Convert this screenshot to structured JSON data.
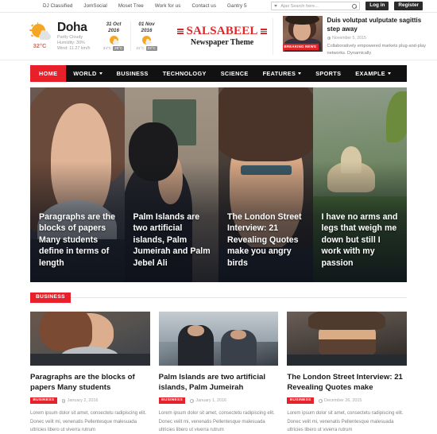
{
  "topbar": {
    "links": [
      {
        "label": "DJ Classified"
      },
      {
        "label": "JomSocial"
      },
      {
        "label": "Moset Tree"
      },
      {
        "label": "Work for us"
      },
      {
        "label": "Contact us"
      },
      {
        "label": "Gantry 5"
      }
    ],
    "search_placeholder": "Ajax Search here...",
    "login_label": "Log in",
    "register_label": "Register"
  },
  "weather": {
    "city": "Doha",
    "condition": "Partly Cloudy",
    "humidity": "Humidity: 30%",
    "wind": "Wind: 11.27 km/h",
    "current_temp": "32°C",
    "forecast": [
      {
        "date_line1": "31 Oct",
        "date_line2": "2016",
        "low": "34°C",
        "high": "28°C"
      },
      {
        "date_line1": "01 Nov",
        "date_line2": "2016",
        "low": "31°C",
        "high": "23°C"
      }
    ]
  },
  "logo": {
    "name": "SALSABEEL",
    "tagline": "Newspaper Theme"
  },
  "breaking": {
    "badge": "BREAKING NEWS",
    "title": "Duis volutpat vulputate sagittis step away",
    "date": "November 5, 2015",
    "excerpt": "Collaboratively empowered markets plug-and-play networks. Dynamically"
  },
  "nav": [
    {
      "label": "HOME",
      "caret": false,
      "active": true
    },
    {
      "label": "WORLD",
      "caret": true,
      "active": false
    },
    {
      "label": "BUSINESS",
      "caret": false,
      "active": false
    },
    {
      "label": "TECHNOLOGY",
      "caret": false,
      "active": false
    },
    {
      "label": "SCIENCE",
      "caret": false,
      "active": false
    },
    {
      "label": "FEATURES",
      "caret": true,
      "active": false
    },
    {
      "label": "SPORTS",
      "caret": false,
      "active": false
    },
    {
      "label": "EXAMPLE",
      "caret": true,
      "active": false
    }
  ],
  "hero": [
    {
      "caption": "Paragraphs are the blocks of papers Many students define in terms of length"
    },
    {
      "caption": "Palm Islands are two artificial islands, Palm Jumeirah and Palm Jebel Ali"
    },
    {
      "caption": "The London Street Interview: 21 Revealing Quotes make you angry birds"
    },
    {
      "caption": "I have no arms and legs that weigh me down but still I work with my passion"
    }
  ],
  "business_section": {
    "tag": "BUSINESS",
    "cards": [
      {
        "title": "Paragraphs are the blocks of papers Many students",
        "tag": "BUSINESS",
        "date": "January 2, 2016",
        "excerpt": "Lorem ipsum dolor sit amet, consectetu radipiscing elit. Donec velit mi, venenatis Pellentesque malesuada ultricies libero ut viverra rutrum"
      },
      {
        "title": "Palm Islands are two artificial islands, Palm Jumeirah",
        "tag": "BUSINESS",
        "date": "January 1, 2016",
        "excerpt": "Lorem ipsum dolor sit amet, consectetu radipiscing elit. Donec velit mi, venenatis Pellentesque malesuada ultricies libero ut viverra rutrum"
      },
      {
        "title": "The London Street Interview: 21 Revealing Quotes make",
        "tag": "BUSINESS",
        "date": "December 26, 2015",
        "excerpt": "Lorem ipsum dolor sit amet, consectetu radipiscing elit. Donec velit mi, venenatis Pellentesque malesuada ultricies libero ut viverra rutrum"
      }
    ]
  },
  "colors": {
    "brand_red": "#e8202a",
    "logo_red": "#e02626",
    "nav_black": "#111111",
    "temp_red": "#e8675a"
  }
}
